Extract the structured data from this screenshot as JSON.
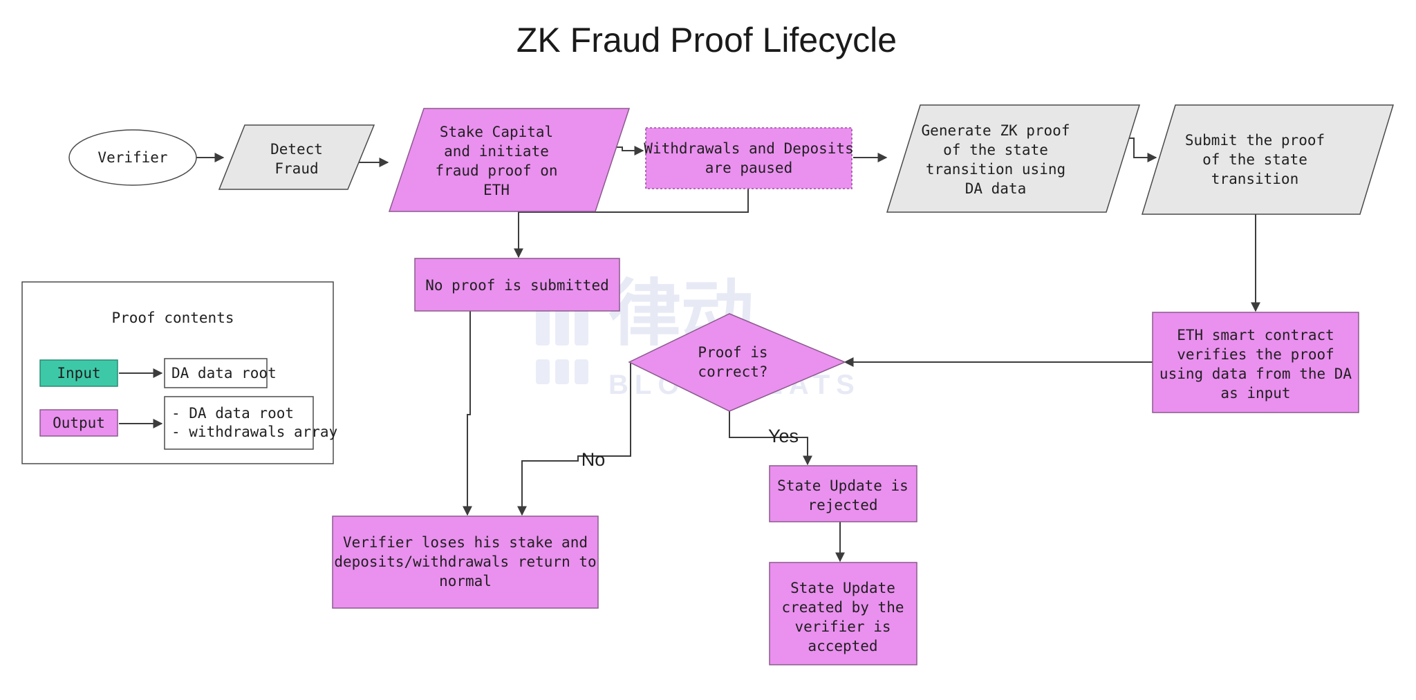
{
  "page": {
    "title": "ZK Fraud Proof Lifecycle",
    "background_color": "#ffffff"
  },
  "colors": {
    "purple_fill": "#ea90ef",
    "purple_stroke": "#8a5a8c",
    "grey_fill": "#e7e7e7",
    "grey_stroke": "#4a4a4a",
    "teal_fill": "#3dc9a7",
    "white_fill": "#ffffff",
    "dotted_stroke": "#9b4fa0",
    "connector": "#3c3c3c",
    "text": "#1f1f1f"
  },
  "nodes": {
    "verifier": {
      "label": "Verifier",
      "shape": "ellipse",
      "fill": "white"
    },
    "detect_fraud": {
      "line1": "Detect",
      "line2": "Fraud",
      "shape": "parallelogram",
      "fill": "grey"
    },
    "stake_capital": {
      "line1": "Stake Capital",
      "line2": "and initiate",
      "line3": "fraud proof on",
      "line4": "ETH",
      "shape": "parallelogram",
      "fill": "purple"
    },
    "withdrawals_paused": {
      "line1": "Withdrawals and Deposits",
      "line2": "are paused",
      "shape": "rect-dotted",
      "fill": "purple"
    },
    "generate_zk_proof": {
      "line1": "Generate ZK proof",
      "line2": "of the state",
      "line3": "transition using",
      "line4": "DA data",
      "shape": "parallelogram",
      "fill": "grey"
    },
    "submit_proof": {
      "line1": "Submit the proof",
      "line2": "of the state",
      "line3": "transition",
      "shape": "parallelogram",
      "fill": "grey"
    },
    "no_proof_submitted": {
      "line1": "No proof is submitted",
      "shape": "rect",
      "fill": "purple"
    },
    "eth_smart_contract": {
      "line1": "ETH smart contract",
      "line2": "verifies the proof",
      "line3": "using data from the DA",
      "line4": "as input",
      "shape": "rect",
      "fill": "purple"
    },
    "proof_correct": {
      "line1": "Proof is",
      "line2": "correct?",
      "shape": "diamond",
      "fill": "purple"
    },
    "verifier_loses_stake": {
      "line1": "Verifier loses his stake and",
      "line2": "deposits/withdrawals return to",
      "line3": "normal",
      "shape": "rect",
      "fill": "purple"
    },
    "state_update_rejected": {
      "line1": "State Update is",
      "line2": "rejected",
      "shape": "rect",
      "fill": "purple"
    },
    "state_update_accepted": {
      "line1": "State Update",
      "line2": "created by the",
      "line3": "verifier is",
      "line4": "accepted",
      "shape": "rect",
      "fill": "purple"
    }
  },
  "edge_labels": {
    "no": "No",
    "yes": "Yes"
  },
  "legend": {
    "title": "Proof contents",
    "input_label": "Input",
    "input_value": "DA data root",
    "output_label": "Output",
    "output_value_line1": "- DA data root",
    "output_value_line2": "- withdrawals array"
  },
  "watermark": {
    "text_cn": "律动",
    "text_en": "BLOCKBEATS"
  }
}
